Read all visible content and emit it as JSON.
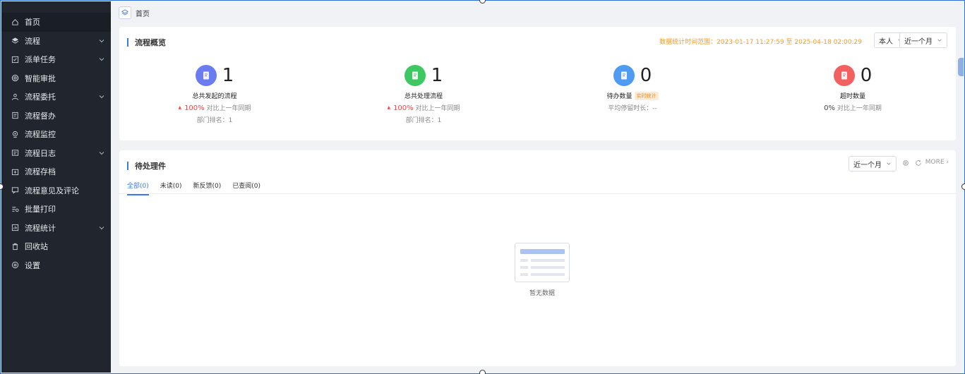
{
  "sidebar": {
    "items": [
      {
        "label": "首页",
        "icon": "home-icon",
        "active": true,
        "expandable": false
      },
      {
        "label": "流程",
        "icon": "layers-icon",
        "active": false,
        "expandable": true
      },
      {
        "label": "派单任务",
        "icon": "task-icon",
        "active": false,
        "expandable": true
      },
      {
        "label": "智能审批",
        "icon": "at-icon",
        "active": false,
        "expandable": false
      },
      {
        "label": "流程委托",
        "icon": "delegate-icon",
        "active": false,
        "expandable": true
      },
      {
        "label": "流程督办",
        "icon": "supervise-icon",
        "active": false,
        "expandable": false
      },
      {
        "label": "流程监控",
        "icon": "monitor-icon",
        "active": false,
        "expandable": false
      },
      {
        "label": "流程日志",
        "icon": "log-icon",
        "active": false,
        "expandable": true
      },
      {
        "label": "流程存档",
        "icon": "archive-icon",
        "active": false,
        "expandable": false
      },
      {
        "label": "流程意见及评论",
        "icon": "comment-icon",
        "active": false,
        "expandable": false
      },
      {
        "label": "批量打印",
        "icon": "print-icon",
        "active": false,
        "expandable": false
      },
      {
        "label": "流程统计",
        "icon": "stats-icon",
        "active": false,
        "expandable": true
      },
      {
        "label": "回收站",
        "icon": "trash-icon",
        "active": false,
        "expandable": false
      },
      {
        "label": "设置",
        "icon": "settings-icon",
        "active": false,
        "expandable": false
      }
    ]
  },
  "breadcrumb": {
    "current": "首页"
  },
  "overview": {
    "title": "流程概览",
    "range_text": "数据统计时间范围：2023-01-17 11:27:59 至 2025-04-18 02:00:29",
    "scope_select": "本人",
    "period_select": "近一个月",
    "stats": [
      {
        "value": "1",
        "label": "总共发起的流程",
        "trend_arrow": "▲",
        "pct": "100%",
        "compare": "对比上一年同期",
        "extra": "部门排名：1",
        "color": "#6a7cf0"
      },
      {
        "value": "1",
        "label": "总共处理流程",
        "trend_arrow": "▲",
        "pct": "100%",
        "compare": "对比上一年同期",
        "extra": "部门排名：1",
        "color": "#3ec862"
      },
      {
        "value": "0",
        "label": "待办数量",
        "tag": "实时统计",
        "extra": "平均停留时长：--",
        "color": "#4f9af2"
      },
      {
        "value": "0",
        "label": "超时数量",
        "pct": "0%",
        "compare": "对比上一年同期",
        "color": "#f26060"
      }
    ]
  },
  "pending": {
    "title": "待处理件",
    "period_select": "近一个月",
    "more": "MORE",
    "tabs": [
      {
        "label": "全部(0)",
        "active": true
      },
      {
        "label": "未读(0)",
        "active": false
      },
      {
        "label": "新反馈(0)",
        "active": false
      },
      {
        "label": "已查阅(0)",
        "active": false
      }
    ],
    "empty_text": "暂无数据"
  }
}
